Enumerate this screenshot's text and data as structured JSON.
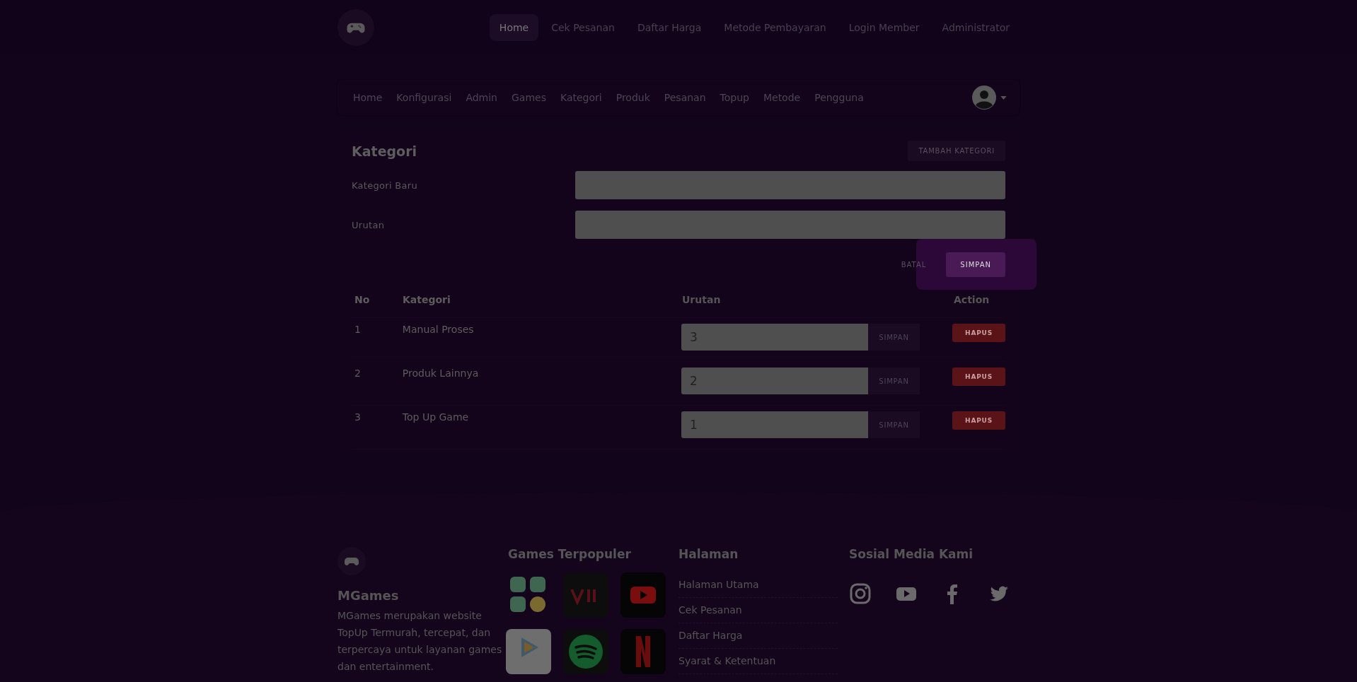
{
  "topnav": {
    "links": [
      {
        "label": "Home",
        "selected": true
      },
      {
        "label": "Cek Pesanan",
        "selected": false
      },
      {
        "label": "Daftar Harga",
        "selected": false
      },
      {
        "label": "Metode Pembayaran",
        "selected": false
      },
      {
        "label": "Login Member",
        "selected": false
      },
      {
        "label": "Administrator",
        "selected": false
      }
    ]
  },
  "admin_nav": {
    "items": [
      "Home",
      "Konfigurasi",
      "Admin",
      "Games",
      "Kategori",
      "Produk",
      "Pesanan",
      "Topup",
      "Metode",
      "Pengguna"
    ]
  },
  "card": {
    "title": "Kategori",
    "add_button": "TAMBAH KATEGORI",
    "fields": [
      {
        "label": "Kategori Baru"
      },
      {
        "label": "Urutan"
      }
    ],
    "cancel_button": "BATAL",
    "save_button": "SIMPAN",
    "table": {
      "columns": [
        "No",
        "Kategori",
        "Urutan",
        "Action"
      ],
      "rows": [
        {
          "no": "1",
          "name": "Manual Proses",
          "order": "3",
          "save": "SIMPAN",
          "delete": "HAPUS"
        },
        {
          "no": "2",
          "name": "Produk Lainnya",
          "order": "2",
          "save": "SIMPAN",
          "delete": "HAPUS"
        },
        {
          "no": "3",
          "name": "Top Up Game",
          "order": "1",
          "save": "SIMPAN",
          "delete": "HAPUS"
        }
      ]
    }
  },
  "footer": {
    "brand": "MGames",
    "description": "MGames merupakan website TopUp Termurah, tercepat, dan terpercaya untuk layanan games dan entertainment.",
    "games_heading": "Games Terpopuler",
    "games": [
      {
        "kind": "wallet"
      },
      {
        "kind": "vidio"
      },
      {
        "kind": "youtube"
      },
      {
        "kind": "wetv"
      },
      {
        "kind": "spotify"
      },
      {
        "kind": "netflix"
      }
    ],
    "pages_heading": "Halaman",
    "pages": [
      "Halaman Utama",
      "Cek Pesanan",
      "Daftar Harga",
      "Syarat & Ketentuan"
    ],
    "social_heading": "Sosial Media Kami",
    "social": [
      {
        "kind": "instagram"
      },
      {
        "kind": "youtube"
      },
      {
        "kind": "facebook"
      },
      {
        "kind": "twitter"
      }
    ]
  }
}
